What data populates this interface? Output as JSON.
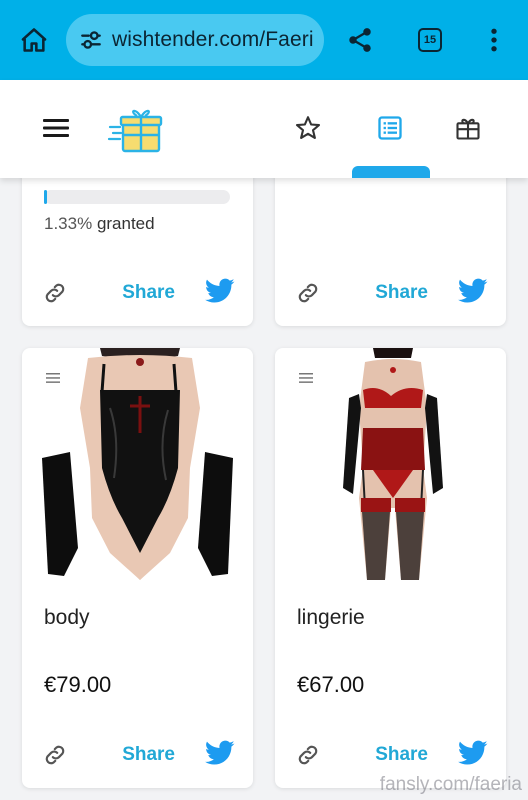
{
  "browser": {
    "url": "wishtender.com/Faeri",
    "tab_count": "15",
    "icons": [
      "home-icon",
      "tune-icon",
      "share-icon",
      "tab-switcher-icon",
      "overflow-menu-icon"
    ]
  },
  "app_header": {
    "icons": [
      "hamburger-menu-icon",
      "wishtender-logo",
      "star-icon",
      "list-icon",
      "gift-icon"
    ],
    "active_tab": "list",
    "accent_color": "#1fa8ea"
  },
  "cards": {
    "top_left": {
      "progress_percent": 1.33,
      "progress_value": "1.33%",
      "progress_suffix": "granted",
      "share_label": "Share"
    },
    "top_right": {
      "share_label": "Share"
    },
    "items": [
      {
        "name": "body",
        "price": "€79.00",
        "share_label": "Share"
      },
      {
        "name": "lingerie",
        "price": "€67.00",
        "share_label": "Share"
      }
    ]
  },
  "watermark": "fansly.com/faeria",
  "colors": {
    "browser_bar": "#00b0e8",
    "share_text": "#21a8d6",
    "twitter_blue": "#1d9bf0"
  }
}
